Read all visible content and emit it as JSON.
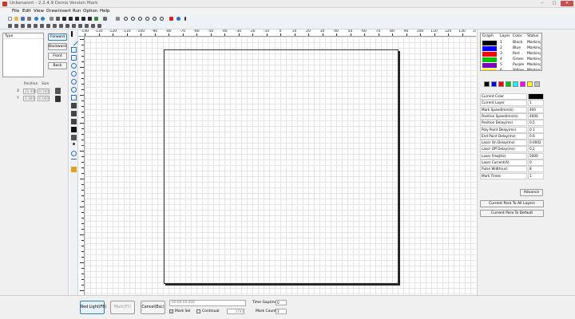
{
  "window": {
    "title": "Unbenannt - 2.2.4.9 Demo Version Mark"
  },
  "menu": [
    "File",
    "Edit",
    "View",
    "Draw",
    "Insert",
    "Run",
    "Option",
    "Help"
  ],
  "object_list": {
    "header": "Type"
  },
  "order_buttons": {
    "forward": "Forward",
    "backward": "Backward",
    "front": "Front",
    "back": "Back"
  },
  "position_size": {
    "position_label": "Position",
    "size_label": "Size",
    "x_label": "X",
    "y_label": "Y",
    "x_position": "24.000",
    "x_size": "0.500",
    "y_position": "0.300",
    "y_size": "0.000"
  },
  "ruler_top_labels": [
    "-140",
    "-130",
    "-120",
    "-110",
    "-100",
    "-90",
    "-80",
    "-70",
    "-60",
    "-50",
    "-40",
    "-30",
    "-20",
    "-10",
    "0",
    "10",
    "20",
    "30",
    "40",
    "50",
    "60",
    "70",
    "80",
    "90",
    "100",
    "110",
    "120",
    "130",
    "140"
  ],
  "layers": {
    "headers": [
      "Graph",
      "Layer",
      "Color",
      "Status"
    ],
    "rows": [
      {
        "layer": "1",
        "color": "Black",
        "status": "Marking",
        "swatch": "#000000"
      },
      {
        "layer": "2",
        "color": "Blue",
        "status": "Marking",
        "swatch": "#0000ff"
      },
      {
        "layer": "3",
        "color": "Red",
        "status": "Marking",
        "swatch": "#ff0000"
      },
      {
        "layer": "4",
        "color": "Green",
        "status": "Marking",
        "swatch": "#00c000"
      },
      {
        "layer": "5",
        "color": "Purple",
        "status": "Marking",
        "swatch": "#8000c0"
      },
      {
        "layer": "6",
        "color": "Yellow",
        "status": "Marking",
        "swatch": "#ffff00"
      }
    ]
  },
  "palette": [
    "#000000",
    "#0000ff",
    "#ff0000",
    "#00c000",
    "#00ffff",
    "#ff00ff",
    "#ffff00",
    "#c0c0c0"
  ],
  "params": [
    {
      "label": "Current Color",
      "value": ""
    },
    {
      "label": "Current Layer",
      "value": "1"
    },
    {
      "label": "Mark Speed(mm/s)",
      "value": "400"
    },
    {
      "label": "Position Speed(mm/s)",
      "value": "4000"
    },
    {
      "label": "Position Delay(ms)",
      "value": "0.5"
    },
    {
      "label": "Poly Point Delay(ms)",
      "value": "0.1"
    },
    {
      "label": "End Point Delay(ms)",
      "value": "0.6"
    },
    {
      "label": "Laser On Delay(ms)",
      "value": "0.0002"
    },
    {
      "label": "Laser Off Delay(ms)",
      "value": "0.2"
    },
    {
      "label": "Laser Freq(Hz)",
      "value": "5000"
    },
    {
      "label": "Laser Current(A)",
      "value": "0"
    },
    {
      "label": "Pulse Width(us)",
      "value": "8"
    },
    {
      "label": "Mark Times",
      "value": "1"
    }
  ],
  "right_buttons": {
    "advance": "Advance",
    "to_all_layers": "Current Para To All Layers",
    "to_default": "Current Para To Default"
  },
  "bottom": {
    "red_light": "Red Light(F8)",
    "mark": "Mark(F5)",
    "cancel": "Cancel(Esc)",
    "time_display": "00:00:00.000",
    "mark_sel_label": "Mark Sel",
    "mark_sel_checked": "✓",
    "continual_label": "Continual",
    "count_value": "3793",
    "time_gap_label": "Time Gap(ms)",
    "time_gap_value": "0",
    "mark_count_label": "Mark Count",
    "mark_count_value": "1"
  }
}
